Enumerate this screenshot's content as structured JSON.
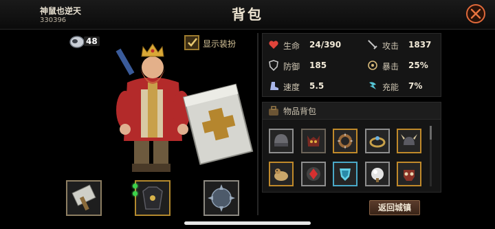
{
  "player": {
    "name": "神鼠也逆天",
    "id": "330396"
  },
  "title": "背包",
  "currency": {
    "amount": "48",
    "icon": "coin-icon"
  },
  "show_equipment": {
    "label": "显示装扮",
    "checked": true
  },
  "stats": [
    {
      "label": "生命",
      "value": "24/390",
      "icon": "heart-icon",
      "color": "#e0443a"
    },
    {
      "label": "攻击",
      "value": "1837",
      "icon": "sword-icon",
      "color": "#b9b9b9"
    },
    {
      "label": "防御",
      "value": "185",
      "icon": "shield-icon",
      "color": "#b9b9b9"
    },
    {
      "label": "暴击",
      "value": "25%",
      "icon": "crit-icon",
      "color": "#d7b97a"
    },
    {
      "label": "速度",
      "value": "5.5",
      "icon": "boot-icon",
      "color": "#a9b6e8"
    },
    {
      "label": "充能",
      "value": "7%",
      "icon": "charge-icon",
      "color": "#56c6d6"
    }
  ],
  "bag": {
    "title": "物品背包"
  },
  "bag_items": [
    {
      "name": "helmet-item"
    },
    {
      "name": "demon-mask-item"
    },
    {
      "name": "spiked-ring-item"
    },
    {
      "name": "ring-item"
    },
    {
      "name": "horned-helmet-item"
    },
    {
      "name": "pet-item"
    },
    {
      "name": "red-gem-item"
    },
    {
      "name": "crystal-shard-item"
    },
    {
      "name": "orb-item"
    },
    {
      "name": "skull-mask-item"
    }
  ],
  "return_button": "返回城镇"
}
